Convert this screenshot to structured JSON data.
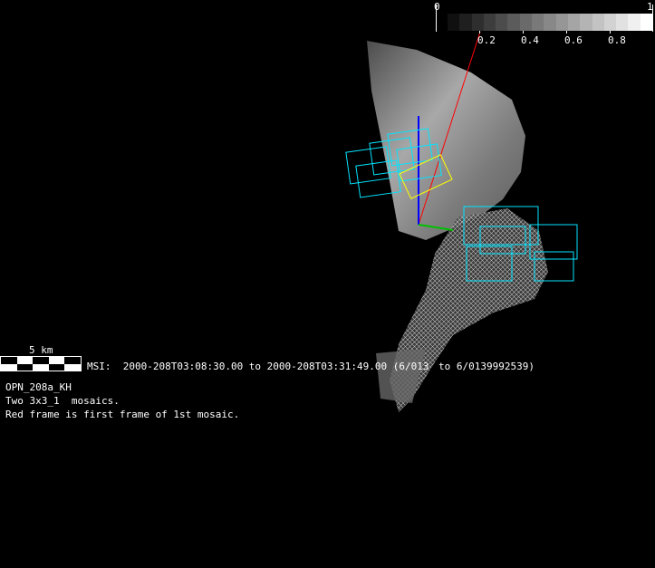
{
  "colorbar": {
    "min_label": "0",
    "max_label": "1",
    "tick_labels": [
      "0.2",
      "0.4",
      "0.6",
      "0.8"
    ],
    "steps": 17
  },
  "scale": {
    "label": "5 km"
  },
  "msi_line": {
    "prefix": "MSI:  2000-208T03:08:30.00 to 2000-208T03:31:49.00 (6/013",
    "suffix": "to 6/0139992539)"
  },
  "info": {
    "line1": "OPN_208a_KH",
    "line2": "Two 3x3_1  mosaics.",
    "line3": "Red frame is first frame of 1st mosaic."
  },
  "colors": {
    "frame": "#00e5ff",
    "first_frame": "#ff0000",
    "axis_x": "#00c000",
    "axis_y": "#0000ff",
    "highlight": "#ffff00"
  }
}
